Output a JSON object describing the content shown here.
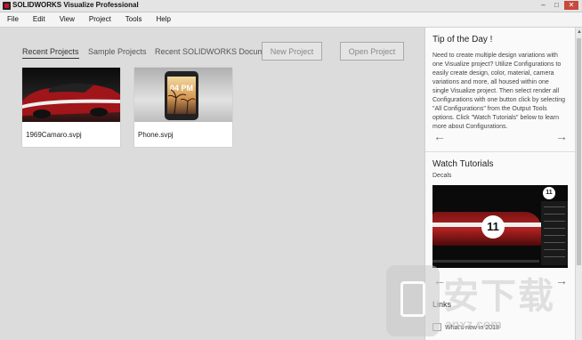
{
  "window": {
    "title": "SOLIDWORKS Visualize Professional",
    "minimize_label": "–",
    "maximize_label": "□",
    "close_label": "✕"
  },
  "menubar": {
    "items": [
      {
        "label": "File"
      },
      {
        "label": "Edit"
      },
      {
        "label": "View"
      },
      {
        "label": "Project"
      },
      {
        "label": "Tools"
      },
      {
        "label": "Help"
      }
    ]
  },
  "tabs": [
    {
      "label": "Recent Projects",
      "active": true
    },
    {
      "label": "Sample Projects",
      "active": false
    },
    {
      "label": "Recent SOLIDWORKS Documents",
      "active": false
    }
  ],
  "buttons": {
    "new_project": "New Project",
    "open_project": "Open Project"
  },
  "projects": [
    {
      "name": "1969Camaro.svpj",
      "thumb": "red-camaro"
    },
    {
      "name": "Phone.svpj",
      "thumb": "phone-sunset",
      "screen_time": "04 PM"
    }
  ],
  "tip": {
    "title": "Tip of the Day !",
    "body": "Need to create multiple design variations with one Visualize project? Utilize Configurations to easily create design, color, material, camera variations and more, all housed within one single Visualize project. Then select render all Configurations with one button click by selecting \"All Configurations\" from the Output Tools options. Click \"Watch Tutorials\" below to learn more about Configurations.",
    "prev_icon": "←",
    "next_icon": "→"
  },
  "tutorials": {
    "title": "Watch Tutorials",
    "subtitle": "Decals",
    "video_badge": "11",
    "prev_icon": "←",
    "next_icon": "→"
  },
  "links": {
    "title": "Links",
    "items": [
      {
        "label": "What's new in 2018"
      }
    ]
  },
  "watermark": {
    "text": "安下载",
    "sub": "anxz.com"
  },
  "colors": {
    "accent_red": "#c8102e",
    "close_button": "#c9483e",
    "panel_bg": "#fafafa",
    "main_bg": "#dcdcdc"
  }
}
